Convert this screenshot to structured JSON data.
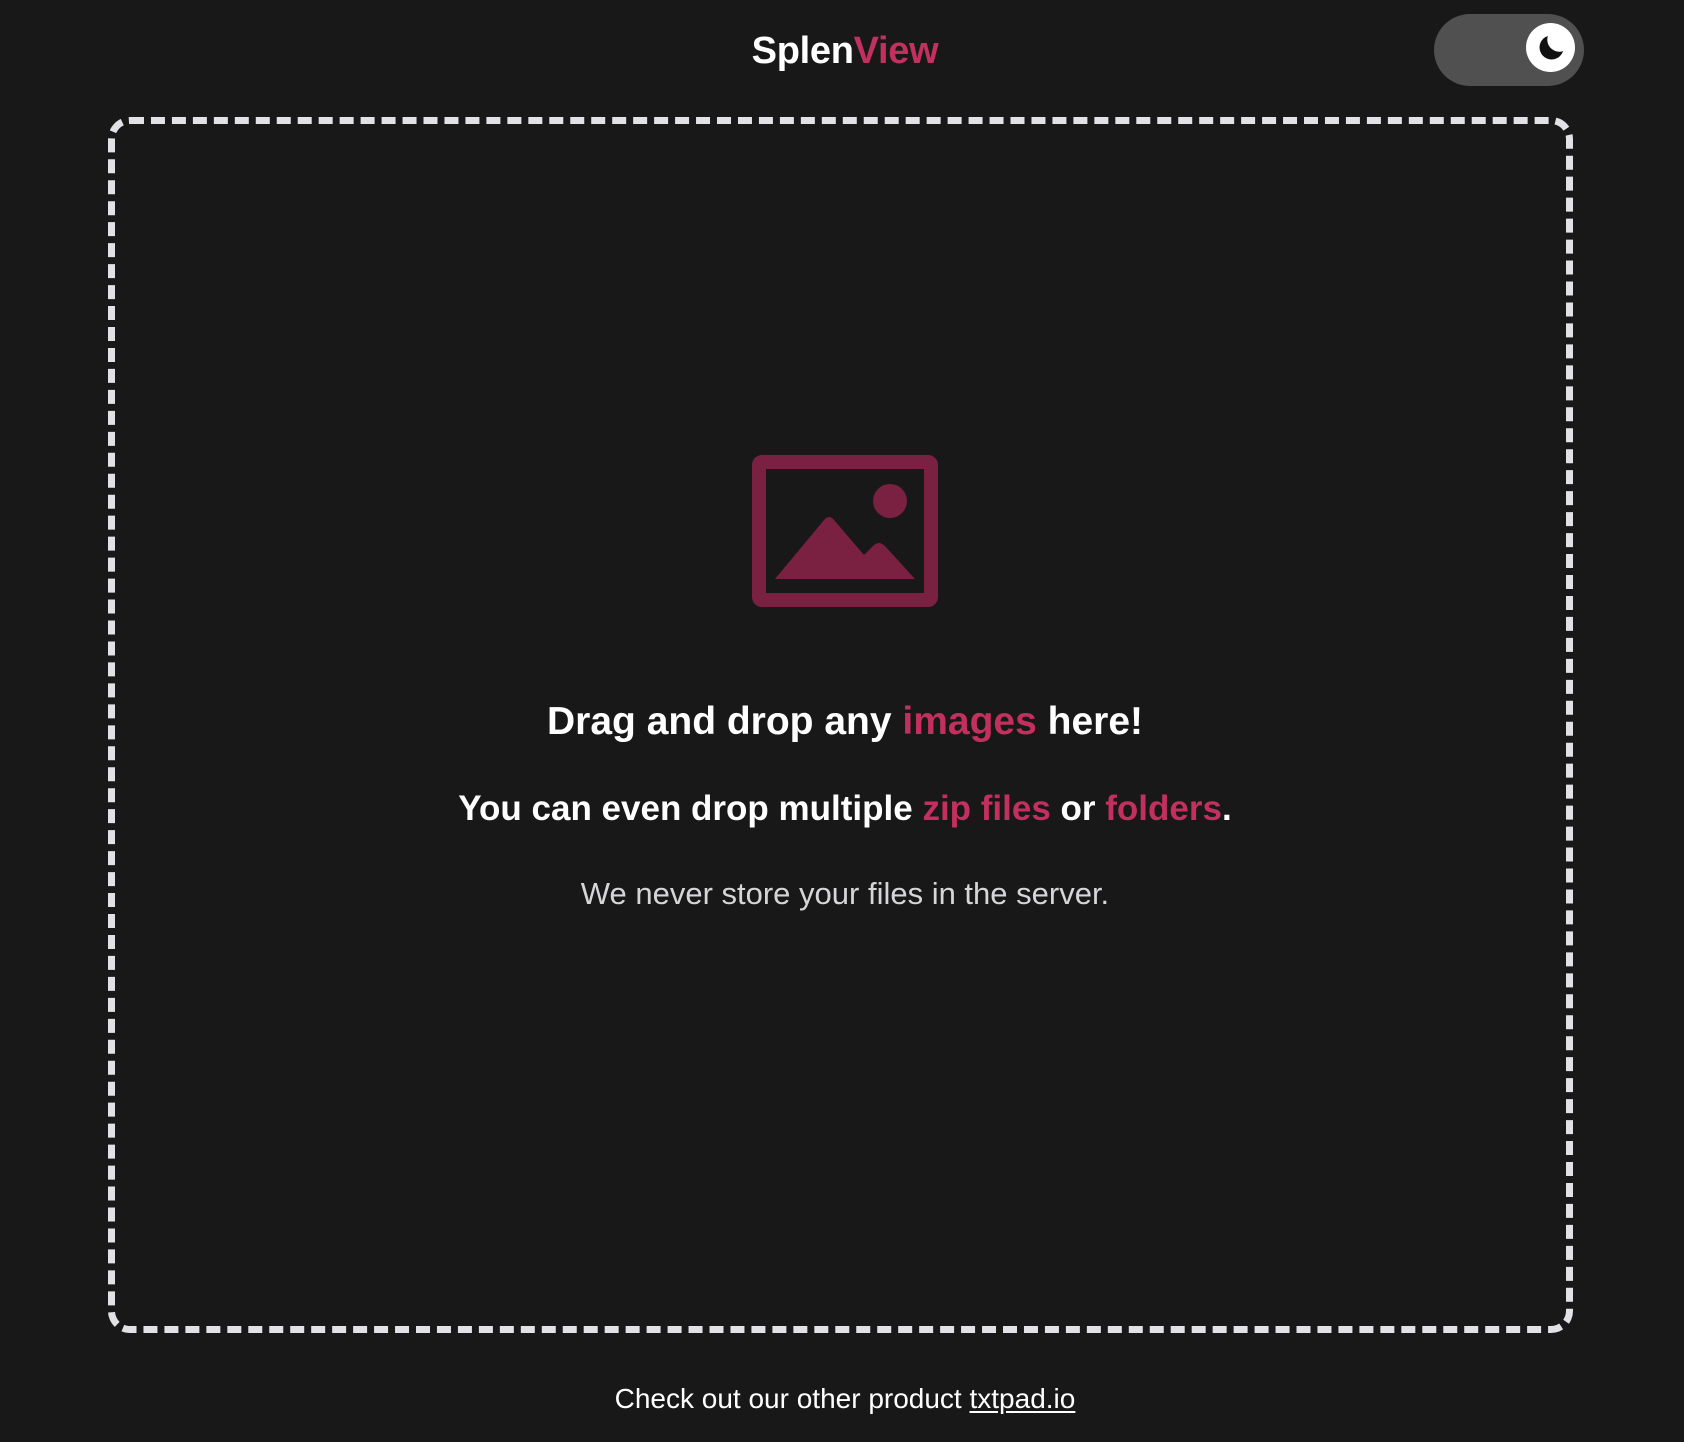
{
  "header": {
    "logo_part1": "Splen",
    "logo_part2": "View",
    "theme_toggle": {
      "state": "dark",
      "icon": "moon-icon"
    }
  },
  "dropzone": {
    "icon": "image-icon",
    "line1": {
      "pre": "Drag and drop any ",
      "highlight": "images",
      "post": " here!"
    },
    "line2": {
      "pre": "You can even drop multiple ",
      "highlight1": "zip files",
      "mid": " or ",
      "highlight2": "folders",
      "post": "."
    },
    "line3": "We never store your files in the server."
  },
  "footer": {
    "text": "Check out our other product ",
    "link_text": "txtpad.io"
  },
  "colors": {
    "background": "#181818",
    "accent": "#c2305f",
    "icon": "#7a2040",
    "dash_border": "#e2e2e6",
    "toggle_track": "#505050"
  }
}
